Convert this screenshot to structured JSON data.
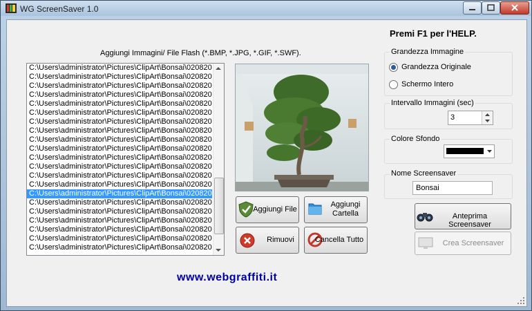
{
  "window": {
    "title": "WG ScreenSaver 1.0"
  },
  "help_text": "Premi F1 per l'HELP.",
  "list": {
    "label": "Aggiungi Immagini/ File Flash (*.BMP, *.JPG, *.GIF, *.SWF).",
    "items": [
      "C:\\Users\\administrator\\Pictures\\ClipArt\\Bonsai\\020820",
      "C:\\Users\\administrator\\Pictures\\ClipArt\\Bonsai\\020820",
      "C:\\Users\\administrator\\Pictures\\ClipArt\\Bonsai\\020820",
      "C:\\Users\\administrator\\Pictures\\ClipArt\\Bonsai\\020820",
      "C:\\Users\\administrator\\Pictures\\ClipArt\\Bonsai\\020820",
      "C:\\Users\\administrator\\Pictures\\ClipArt\\Bonsai\\020820",
      "C:\\Users\\administrator\\Pictures\\ClipArt\\Bonsai\\020820",
      "C:\\Users\\administrator\\Pictures\\ClipArt\\Bonsai\\020820",
      "C:\\Users\\administrator\\Pictures\\ClipArt\\Bonsai\\020820",
      "C:\\Users\\administrator\\Pictures\\ClipArt\\Bonsai\\020820",
      "C:\\Users\\administrator\\Pictures\\ClipArt\\Bonsai\\020820",
      "C:\\Users\\administrator\\Pictures\\ClipArt\\Bonsai\\020820",
      "C:\\Users\\administrator\\Pictures\\ClipArt\\Bonsai\\020820",
      "C:\\Users\\administrator\\Pictures\\ClipArt\\Bonsai\\020820",
      "C:\\Users\\administrator\\Pictures\\ClipArt\\Bonsai\\020820",
      "C:\\Users\\administrator\\Pictures\\ClipArt\\Bonsai\\020820",
      "C:\\Users\\administrator\\Pictures\\ClipArt\\Bonsai\\020820",
      "C:\\Users\\administrator\\Pictures\\ClipArt\\Bonsai\\020820",
      "C:\\Users\\administrator\\Pictures\\ClipArt\\Bonsai\\020820",
      "C:\\Users\\administrator\\Pictures\\ClipArt\\Bonsai\\020820",
      "C:\\Users\\administrator\\Pictures\\ClipArt\\Bonsai\\020820"
    ],
    "selected_index": 14
  },
  "buttons": {
    "add_file": "Aggiungi File",
    "add_folder_line1": "Aggiungi",
    "add_folder_line2": "Cartella",
    "remove": "Rimuovi",
    "delete_all": "Cancella Tutto",
    "preview": "Anteprima Screensaver",
    "create": "Crea Screensaver"
  },
  "image_size": {
    "label": "Grandezza Immagine",
    "options": [
      "Grandezza Originale",
      "Schermo Intero"
    ],
    "selected": "Grandezza Originale"
  },
  "interval": {
    "label": "Intervallo Immagini (sec)",
    "value": "3"
  },
  "background": {
    "label": "Colore Sfondo",
    "color": "#000000"
  },
  "name": {
    "label": "Nome Screensaver",
    "value": "Bonsai"
  },
  "website": "www.webgraffiti.it",
  "colors": {
    "selection": "#3399ff",
    "link": "#0000a0",
    "accent": "#2e5d95"
  }
}
